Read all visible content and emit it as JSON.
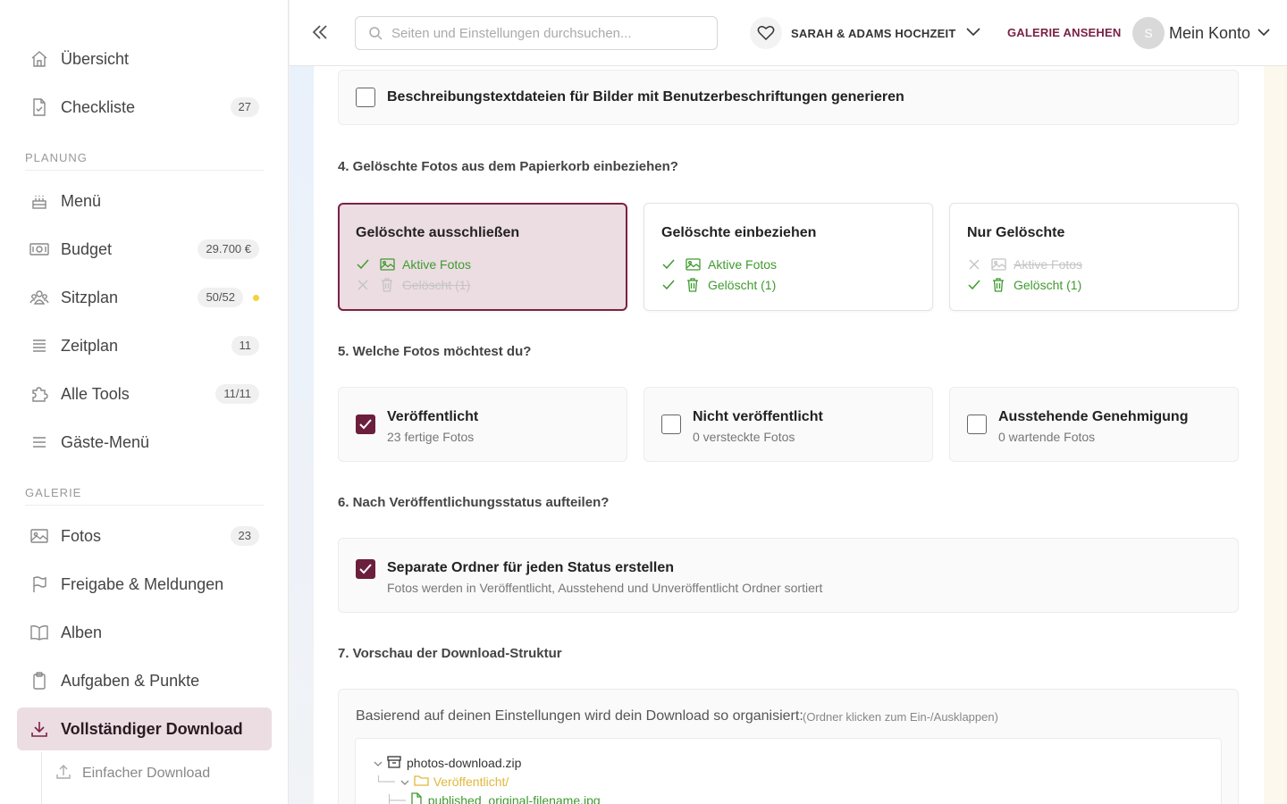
{
  "sidebar": {
    "items": [
      {
        "label": "Übersicht",
        "icon": "home-icon"
      },
      {
        "label": "Checkliste",
        "icon": "checklist-icon",
        "badge": "27"
      },
      {
        "label": "Menü",
        "icon": "cake-icon"
      },
      {
        "label": "Budget",
        "icon": "money-icon",
        "badge": "29.700 €"
      },
      {
        "label": "Sitzplan",
        "icon": "users-icon",
        "badge": "50/52",
        "dot_color": "#f3d23b"
      },
      {
        "label": "Zeitplan",
        "icon": "list-icon",
        "badge": "11"
      },
      {
        "label": "Alle Tools",
        "icon": "puzzle-icon",
        "badge": "11/11"
      },
      {
        "label": "Gäste-Menü",
        "icon": "menu-icon"
      },
      {
        "label": "Fotos",
        "icon": "image-icon",
        "badge": "23"
      },
      {
        "label": "Freigabe & Meldungen",
        "icon": "flag-icon"
      },
      {
        "label": "Alben",
        "icon": "book-icon"
      },
      {
        "label": "Aufgaben & Punkte",
        "icon": "clipboard-icon"
      },
      {
        "label": "Vollständiger Download",
        "icon": "download-icon",
        "active": true
      }
    ],
    "sections": {
      "planning": "PLANUNG",
      "gallery": "GALERIE"
    },
    "sub_item": {
      "label": "Einfacher Download",
      "icon": "upload-icon"
    }
  },
  "header": {
    "search_placeholder": "Seiten und Einstellungen durchsuchen...",
    "event_name": "SARAH & ADAMS HOCHZEIT",
    "gallery_link": "GALERIE ANSEHEN",
    "avatar_initial": "S",
    "account_label": "Mein Konto"
  },
  "main": {
    "caption_option": {
      "label": "Beschreibungstextdateien für Bilder mit Benutzerbeschriftungen generieren",
      "checked": false
    },
    "q4": {
      "title": "4. Gelöschte Fotos aus dem Papierkorb einbeziehen?",
      "options": [
        {
          "title": "Gelöschte ausschließen",
          "selected": true,
          "active_label": "Aktive Fotos",
          "active_on": true,
          "deleted_label": "Gelöscht (1)",
          "deleted_on": false
        },
        {
          "title": "Gelöschte einbeziehen",
          "selected": false,
          "active_label": "Aktive Fotos",
          "active_on": true,
          "deleted_label": "Gelöscht (1)",
          "deleted_on": true
        },
        {
          "title": "Nur Gelöschte",
          "selected": false,
          "active_label": "Aktive Fotos",
          "active_on": false,
          "deleted_label": "Gelöscht (1)",
          "deleted_on": true
        }
      ]
    },
    "q5": {
      "title": "5. Welche Fotos möchtest du?",
      "options": [
        {
          "title": "Veröffentlicht",
          "sub": "23 fertige Fotos",
          "checked": true
        },
        {
          "title": "Nicht veröffentlicht",
          "sub": "0 versteckte Fotos",
          "checked": false
        },
        {
          "title": "Ausstehende Genehmigung",
          "sub": "0 wartende Fotos",
          "checked": false
        }
      ]
    },
    "q6": {
      "title": "6. Nach Veröffentlichungsstatus aufteilen?",
      "option": {
        "title": "Separate Ordner für jeden Status erstellen",
        "sub": "Fotos werden in Veröffentlicht, Ausstehend und Unveröffentlicht Ordner sortiert",
        "checked": true
      }
    },
    "q7": {
      "title": "7. Vorschau der Download-Struktur",
      "intro": "Basierend auf deinen Einstellungen wird dein Download so organisiert:",
      "hint": "(Ordner klicken zum Ein-/Ausklappen)",
      "tree": {
        "root": "photos-download.zip",
        "folder": "Veröffentlicht/",
        "file": "published_original-filename.jpg"
      }
    }
  },
  "colors": {
    "accent": "#7b2145",
    "accent_bg": "#ecdde2",
    "green": "#3f9a2f",
    "folder": "#e0b83a"
  }
}
